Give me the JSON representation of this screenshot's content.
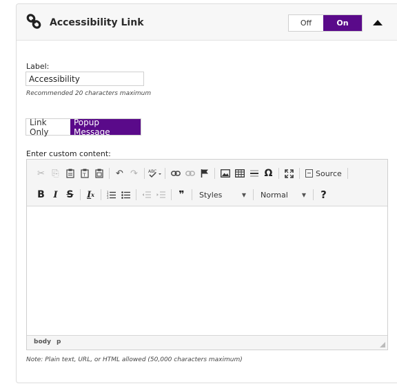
{
  "header": {
    "title": "Accessibility Link",
    "toggle": {
      "off_label": "Off",
      "on_label": "On",
      "selected": "On"
    }
  },
  "label_field": {
    "label": "Label:",
    "value": "Accessibility",
    "hint": "Recommended 20 characters maximum"
  },
  "mode": {
    "options": [
      "Link Only",
      "Popup Message"
    ],
    "selected": "Popup Message"
  },
  "content": {
    "label": "Enter custom content:",
    "toolbar": {
      "source_label": "Source",
      "styles_label": "Styles",
      "format_label": "Normal",
      "help_label": "?"
    },
    "status_path": [
      "body",
      "p"
    ],
    "note": "Note: Plain text, URL, or HTML allowed (50,000 characters maximum)"
  },
  "colors": {
    "accent": "#5a0a8a"
  }
}
